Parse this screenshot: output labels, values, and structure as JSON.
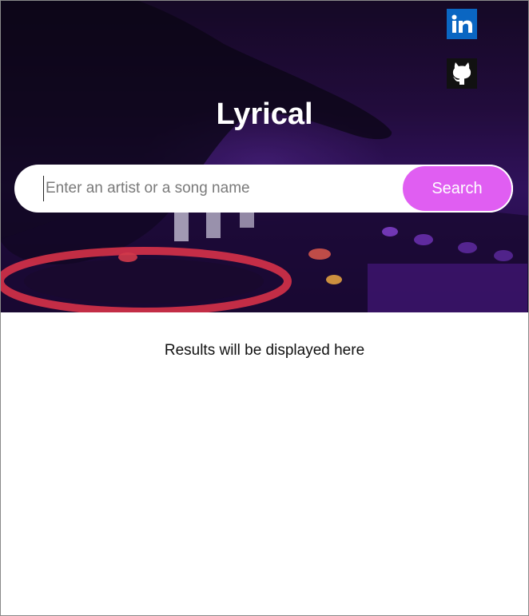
{
  "header": {
    "title": "Lyrical",
    "social": [
      {
        "name": "LinkedIn",
        "icon": "linkedin-icon",
        "color": "#0a66c2"
      },
      {
        "name": "GitHub",
        "icon": "github-icon",
        "color": "#111111"
      }
    ]
  },
  "search": {
    "placeholder": "Enter an artist or a song name",
    "value": "",
    "button_label": "Search",
    "button_color": "#e05ef2"
  },
  "results": {
    "message": "Results will be displayed here"
  },
  "theme": {
    "hero_color": "#2a0f4a",
    "accent": "#e05ef2"
  }
}
